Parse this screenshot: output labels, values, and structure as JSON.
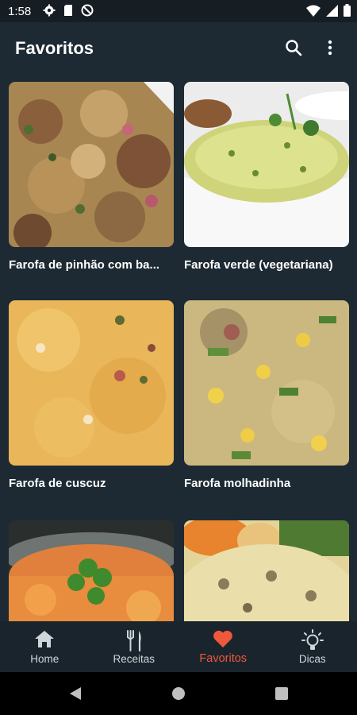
{
  "status": {
    "time": "1:58",
    "left_icons": [
      "gear-icon",
      "sd-card-icon",
      "no-tracking-icon"
    ],
    "right_icons": [
      "wifi-icon",
      "signal-icon",
      "battery-icon"
    ]
  },
  "app_bar": {
    "title": "Favoritos",
    "icons": [
      "search-icon",
      "more-vert-icon"
    ]
  },
  "recipes": [
    {
      "title": "Farofa de pinhão com ba..."
    },
    {
      "title": "Farofa verde (vegetariana)"
    },
    {
      "title": "Farofa de cuscuz"
    },
    {
      "title": "Farofa molhadinha"
    },
    {
      "title": ""
    },
    {
      "title": ""
    }
  ],
  "bottom_nav": {
    "items": [
      {
        "label": "Home",
        "icon": "home-icon",
        "active": false
      },
      {
        "label": "Receitas",
        "icon": "fork-knife-icon",
        "active": false
      },
      {
        "label": "Favoritos",
        "icon": "heart-icon",
        "active": true
      },
      {
        "label": "Dicas",
        "icon": "lightbulb-icon",
        "active": false
      }
    ]
  },
  "colors": {
    "background": "#1e2a33",
    "accent": "#f0583c"
  }
}
